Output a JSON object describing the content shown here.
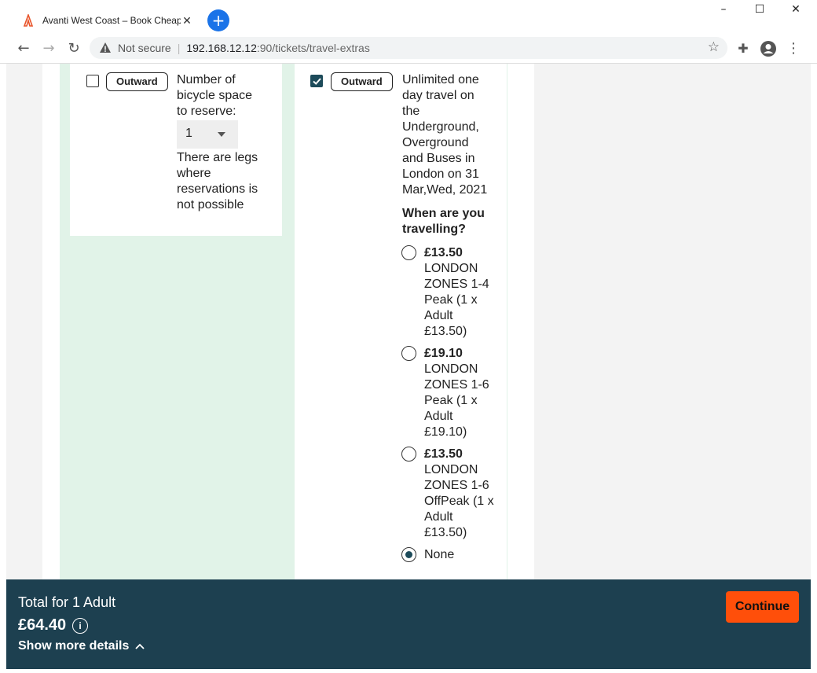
{
  "browser": {
    "tab_title": "Avanti West Coast – Book Cheap",
    "new_tab": "+",
    "security_label": "Not secure",
    "url_host": "192.168.12.12",
    "url_path": ":90/tickets/travel-extras",
    "minimize": "–",
    "maximize": "☐",
    "close": "✕"
  },
  "left_card": {
    "badge": "Outward",
    "checked": false,
    "label_lines": [
      "Number of",
      "bicycle space",
      "to reserve:"
    ],
    "quantity": "1",
    "note_lines": [
      "There are legs",
      "where",
      "reservations is",
      "not possible"
    ]
  },
  "right_card": {
    "badge": "Outward",
    "checked": true,
    "desc_lines": [
      "Unlimited one",
      "day travel on",
      "the",
      "Underground,",
      "Overground",
      "and Buses in",
      "London on 31",
      "Mar,Wed, 2021"
    ],
    "question_lines": [
      "When are you",
      "travelling?"
    ],
    "options": [
      {
        "price": "£13.50",
        "lines": [
          "LONDON",
          "ZONES 1-4",
          "Peak (1 x",
          "Adult",
          "£13.50)"
        ],
        "selected": false
      },
      {
        "price": "£19.10",
        "lines": [
          "LONDON",
          "ZONES 1-6",
          "Peak (1 x",
          "Adult",
          "£19.10)"
        ],
        "selected": false
      },
      {
        "price": "£13.50",
        "lines": [
          "LONDON",
          "ZONES 1-6",
          "OffPeak (1 x",
          "Adult",
          "£13.50)"
        ],
        "selected": false
      },
      {
        "price": "",
        "lines": [
          "None"
        ],
        "selected": true
      }
    ]
  },
  "footer": {
    "total_label": "Total for 1 Adult",
    "total_price": "£64.40",
    "info": "i",
    "show_more": "Show more details",
    "continue": "Continue"
  },
  "colors": {
    "accent": "#ff4f0a",
    "footer": "#1d4050",
    "green_bg": "#e1f3e8"
  }
}
